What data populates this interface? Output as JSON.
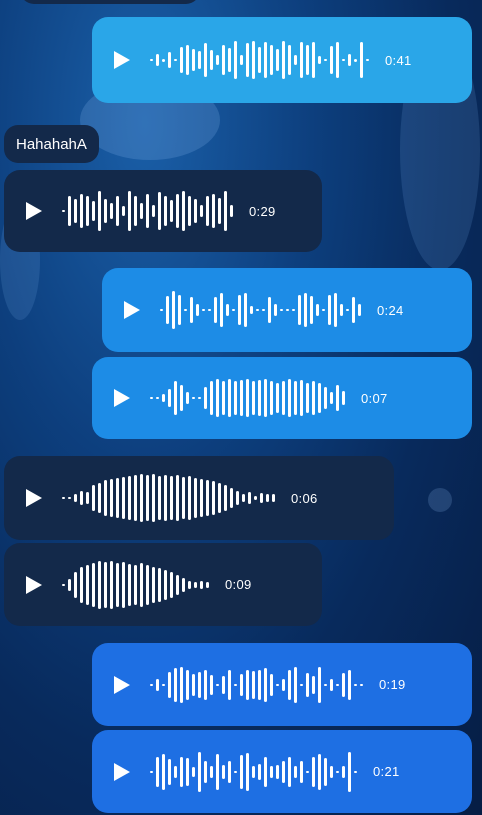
{
  "text_message": {
    "text": "HahahahA"
  },
  "voice_messages": [
    {
      "direction": "out",
      "color": "c1",
      "duration": "0:41",
      "wave": [
        2,
        12,
        3,
        16,
        2,
        26,
        30,
        22,
        18,
        34,
        20,
        10,
        30,
        24,
        38,
        10,
        34,
        38,
        26,
        36,
        30,
        22,
        38,
        30,
        10,
        36,
        30,
        36,
        8,
        2,
        28,
        36,
        2,
        12,
        3,
        36,
        2
      ]
    },
    {
      "direction": "in",
      "duration": "0:29",
      "wave": [
        2,
        30,
        24,
        34,
        30,
        20,
        40,
        24,
        16,
        30,
        10,
        40,
        30,
        16,
        34,
        12,
        38,
        30,
        22,
        34,
        40,
        30,
        24,
        12,
        30,
        34,
        26,
        40,
        12
      ]
    },
    {
      "direction": "out",
      "color": "c2",
      "duration": "0:24",
      "wave": [
        2,
        28,
        38,
        30,
        2,
        26,
        12,
        2,
        2,
        26,
        34,
        12,
        2,
        30,
        34,
        8,
        2,
        2,
        26,
        12,
        2,
        2,
        2,
        30,
        34,
        28,
        12,
        2,
        30,
        34,
        12,
        2,
        26,
        12
      ]
    },
    {
      "direction": "out",
      "color": "c2",
      "duration": "0:07",
      "wave": [
        2,
        2,
        8,
        18,
        34,
        26,
        12,
        2,
        2,
        22,
        34,
        38,
        34,
        38,
        34,
        36,
        38,
        34,
        36,
        38,
        34,
        30,
        34,
        38,
        34,
        36,
        30,
        34,
        30,
        22,
        12,
        26,
        14
      ]
    },
    {
      "direction": "in",
      "duration": "0:06",
      "wave": [
        2,
        2,
        8,
        14,
        12,
        26,
        30,
        36,
        38,
        40,
        42,
        44,
        46,
        48,
        46,
        48,
        44,
        46,
        44,
        46,
        42,
        44,
        40,
        38,
        36,
        34,
        30,
        26,
        20,
        14,
        8,
        12,
        4,
        10,
        8,
        8
      ]
    },
    {
      "direction": "in",
      "duration": "0:09",
      "wave": [
        2,
        12,
        26,
        36,
        40,
        44,
        48,
        46,
        48,
        44,
        46,
        42,
        40,
        44,
        40,
        36,
        34,
        30,
        26,
        20,
        14,
        8,
        6,
        8,
        6
      ]
    },
    {
      "direction": "out",
      "color": "c3",
      "duration": "0:19",
      "wave": [
        2,
        12,
        2,
        26,
        34,
        36,
        30,
        22,
        26,
        30,
        20,
        2,
        18,
        30,
        2,
        22,
        30,
        28,
        30,
        34,
        22,
        2,
        12,
        30,
        36,
        2,
        24,
        18,
        36,
        2,
        12,
        2,
        24,
        30,
        2,
        2
      ]
    },
    {
      "direction": "out",
      "color": "c3",
      "duration": "0:21",
      "wave": [
        2,
        30,
        36,
        26,
        12,
        30,
        28,
        10,
        40,
        22,
        12,
        36,
        14,
        22,
        2,
        34,
        38,
        12,
        16,
        30,
        12,
        14,
        22,
        30,
        12,
        22,
        2,
        30,
        36,
        28,
        12,
        2,
        12,
        40,
        2
      ]
    }
  ]
}
